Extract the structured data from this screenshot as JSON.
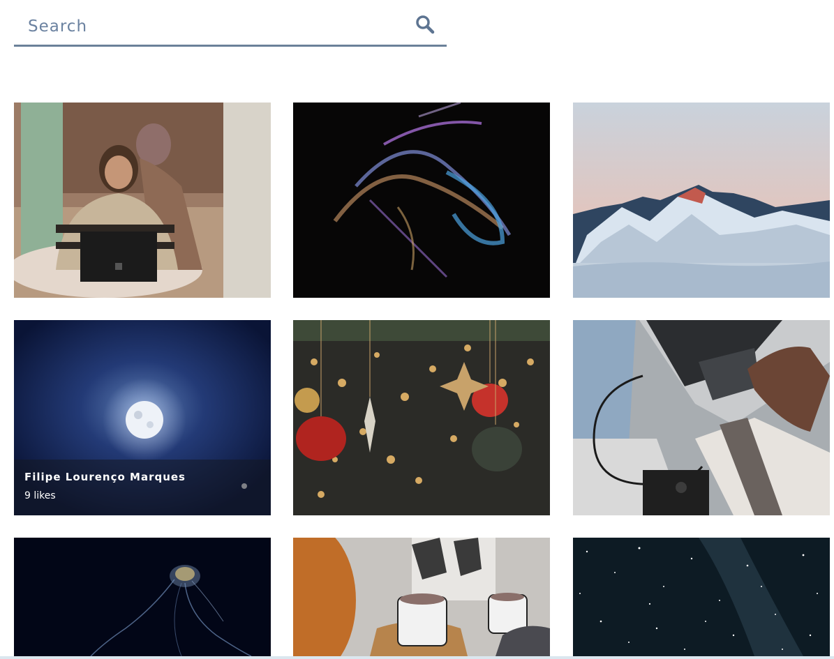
{
  "search": {
    "placeholder": "Search",
    "value": "",
    "icon": "search-icon"
  },
  "accent_color": "#6b8199",
  "photos": [
    {
      "subject": "two women at laptop in cafe",
      "hover": false
    },
    {
      "subject": "abstract colorful particle swirl",
      "hover": false
    },
    {
      "subject": "snowy mountain range at sunset",
      "hover": false
    },
    {
      "subject": "full moon in night sky",
      "hover": true,
      "author": "Filipe Lourenço Marques",
      "likes_label": "9 likes"
    },
    {
      "subject": "christmas ornaments with bokeh lights",
      "hover": false
    },
    {
      "subject": "samsung portable ssd with laptop",
      "hover": false
    },
    {
      "subject": "glowing jellyfish",
      "hover": false
    },
    {
      "subject": "two mugs held in mittens",
      "hover": false
    },
    {
      "subject": "starry night sky",
      "hover": false
    }
  ]
}
